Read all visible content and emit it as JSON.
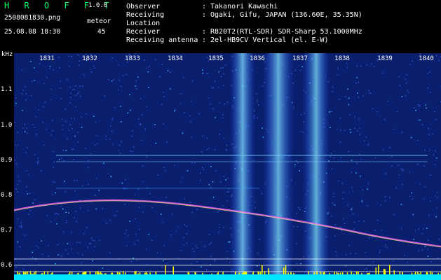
{
  "header": {
    "brand": "H R O F F T",
    "version": "1.0.0",
    "filename": "2508081830.png",
    "datetime": "25.08.08 18:30",
    "meteor_label": "meteor",
    "meteor_count": "45"
  },
  "info": [
    {
      "key": "Observer",
      "value": "Takanori Kawachi"
    },
    {
      "key": "Receiving Location",
      "value": "Ogaki, Gifu, JAPAN (136.60E, 35.35N)"
    },
    {
      "key": "Receiver",
      "value": "R820T2(RTL-SDR) SDR-Sharp 53.1000MHz"
    },
    {
      "key": "Receiving antenna",
      "value": "2el-HB9CV Vertical (el. E-W)"
    }
  ],
  "axis": {
    "unit": "kHz",
    "x_ticks": [
      "1831",
      "1832",
      "1833",
      "1834",
      "1835",
      "1836",
      "1837",
      "1838",
      "1839",
      "1840"
    ],
    "y_ticks": [
      "1.1",
      "1.0",
      "0.9",
      "0.8",
      "0.7",
      "0.6"
    ]
  },
  "colors": {
    "background": "#000000",
    "spectrogram_base": "#0a1f6e",
    "brand": "#00ff66",
    "trace": "#ff66ff",
    "bottom_band": "#00e5ff",
    "bursts": "#ffff00"
  }
}
